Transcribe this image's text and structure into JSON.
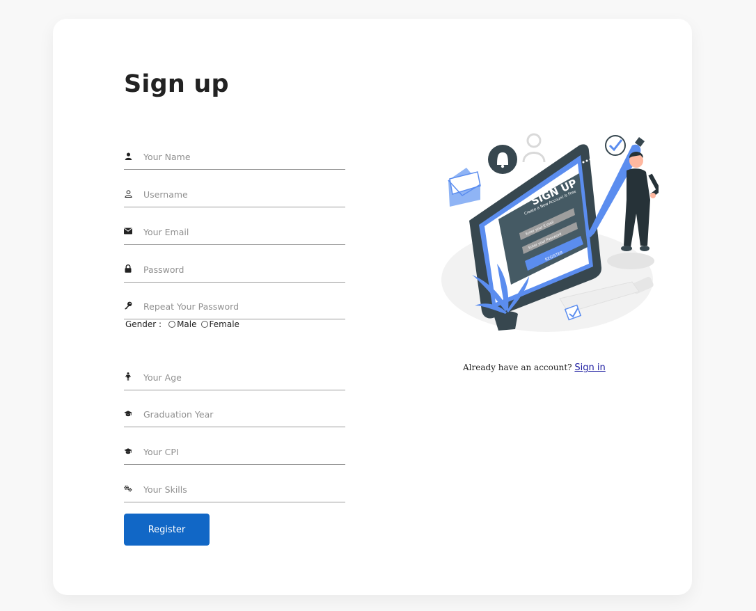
{
  "form": {
    "title": "Sign up",
    "fields": [
      {
        "name": "name",
        "icon": "user-icon",
        "placeholder": "Your Name"
      },
      {
        "name": "username",
        "icon": "user-outline-icon",
        "placeholder": "Username"
      },
      {
        "name": "email",
        "icon": "envelope-icon",
        "placeholder": "Your Email"
      },
      {
        "name": "password",
        "icon": "lock-icon",
        "placeholder": "Password"
      },
      {
        "name": "repeat_password",
        "icon": "key-icon",
        "placeholder": "Repeat Your Password"
      },
      {
        "name": "age",
        "icon": "person-standing-icon",
        "placeholder": "Your Age"
      },
      {
        "name": "graduation_year",
        "icon": "graduation-cap-icon",
        "placeholder": "Graduation Year"
      },
      {
        "name": "cpi",
        "icon": "graduation-cap-icon",
        "placeholder": "Your CPI"
      },
      {
        "name": "skills",
        "icon": "gears-icon",
        "placeholder": "Your Skills"
      }
    ],
    "gender": {
      "label": "Gender :",
      "options": [
        "Male",
        "Female"
      ]
    },
    "register_label": "Register"
  },
  "illustration": {
    "screen_title": "SIGN UP",
    "screen_subtitle": "Create a New Account is Free",
    "screen_field_1": "Enter your E-mail",
    "screen_field_2": "Enter your Password",
    "screen_button": "REGISTER"
  },
  "signin": {
    "prompt": "Already have an account?",
    "link_label": "Sign in"
  },
  "colors": {
    "accent": "#1167c6",
    "illustration_blue": "#5b8def",
    "background": "#f8f8f8"
  }
}
